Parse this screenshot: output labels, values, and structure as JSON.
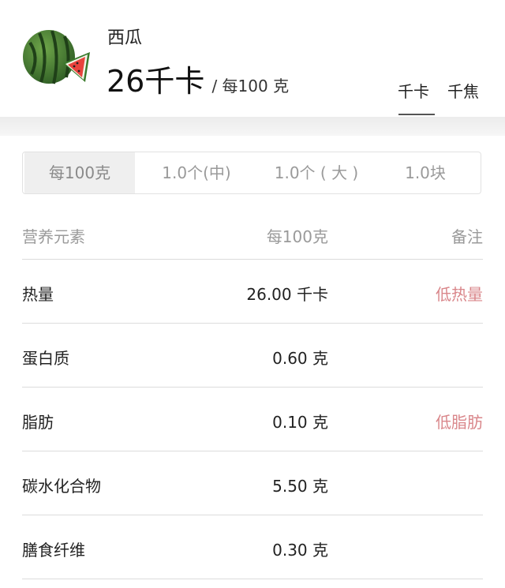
{
  "food": {
    "name": "西瓜",
    "energy_value": "26千卡",
    "energy_unit": "/ 每100 克",
    "icon": "watermelon-icon"
  },
  "unit_toggle": {
    "kcal": "千卡",
    "kj": "千焦",
    "selected": "千卡"
  },
  "portions": {
    "items": [
      "每100克",
      "1.0个(中)",
      "1.0个 ( 大 )",
      "1.0块"
    ],
    "selected": "每100克"
  },
  "table": {
    "headers": [
      "营养元素",
      "每100克",
      "备注"
    ],
    "rows": [
      {
        "name": "热量",
        "value": "26.00 千卡",
        "note": "低热量"
      },
      {
        "name": "蛋白质",
        "value": "0.60 克",
        "note": ""
      },
      {
        "name": "脂肪",
        "value": "0.10 克",
        "note": "低脂肪"
      },
      {
        "name": "碳水化合物",
        "value": "5.50 克",
        "note": ""
      },
      {
        "name": "膳食纤维",
        "value": "0.30 克",
        "note": ""
      }
    ]
  },
  "colors": {
    "note_accent": "#d9868a",
    "divider": "#dcdcdc",
    "muted_text": "#9a9a9a"
  }
}
